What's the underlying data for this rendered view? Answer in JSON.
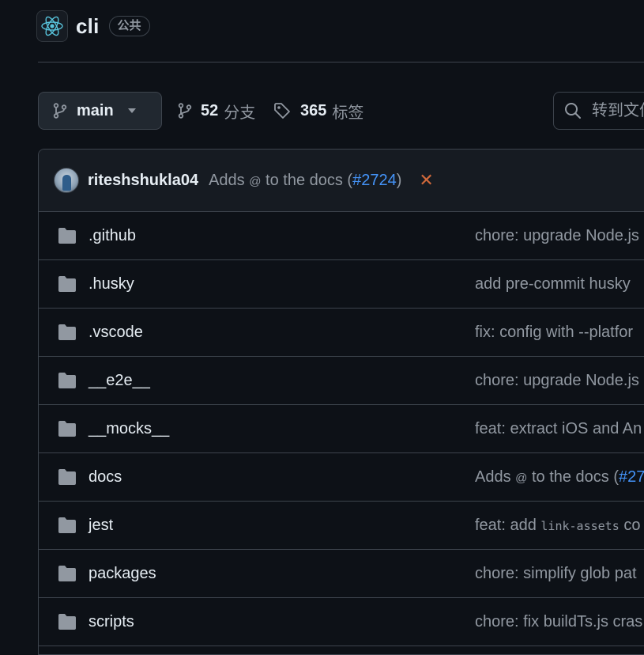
{
  "repo": {
    "name": "cli",
    "visibility": "公共",
    "logo_icon": "react-logo-icon"
  },
  "toolbar": {
    "branch_label": "main",
    "branch_count": "52",
    "branch_unit": "分支",
    "tag_count": "365",
    "tag_unit": "标签",
    "search_placeholder": "转到文件"
  },
  "latest_commit": {
    "author": "riteshshukla04",
    "message_pre": "Adds",
    "message_at": "@",
    "message_post": "to the docs (",
    "pr_link": "#2724",
    "message_close": ")",
    "status": "✕",
    "status_color": "#d1693b"
  },
  "files": [
    {
      "name": ".github",
      "msg": "chore: upgrade Node.js"
    },
    {
      "name": ".husky",
      "msg": "add pre-commit husky"
    },
    {
      "name": ".vscode",
      "msg": "fix: config with --platfor"
    },
    {
      "name": "__e2e__",
      "msg": "chore: upgrade Node.js"
    },
    {
      "name": "__mocks__",
      "msg": "feat: extract iOS and An"
    },
    {
      "name": "docs",
      "msg_pre": "Adds",
      "msg_at": "@",
      "msg_post": "to the docs (",
      "msg_link": "#27"
    },
    {
      "name": "jest",
      "msg_pre": "feat: add",
      "msg_code": "link-assets",
      "msg_post": "co"
    },
    {
      "name": "packages",
      "msg": "chore: simplify glob pat"
    },
    {
      "name": "scripts",
      "msg": "chore: fix buildTs.js cras"
    }
  ],
  "colors": {
    "background": "#0d1117",
    "link": "#4493f8",
    "muted": "#9198a1",
    "border": "#3d444d",
    "folder": "#9198a1"
  }
}
